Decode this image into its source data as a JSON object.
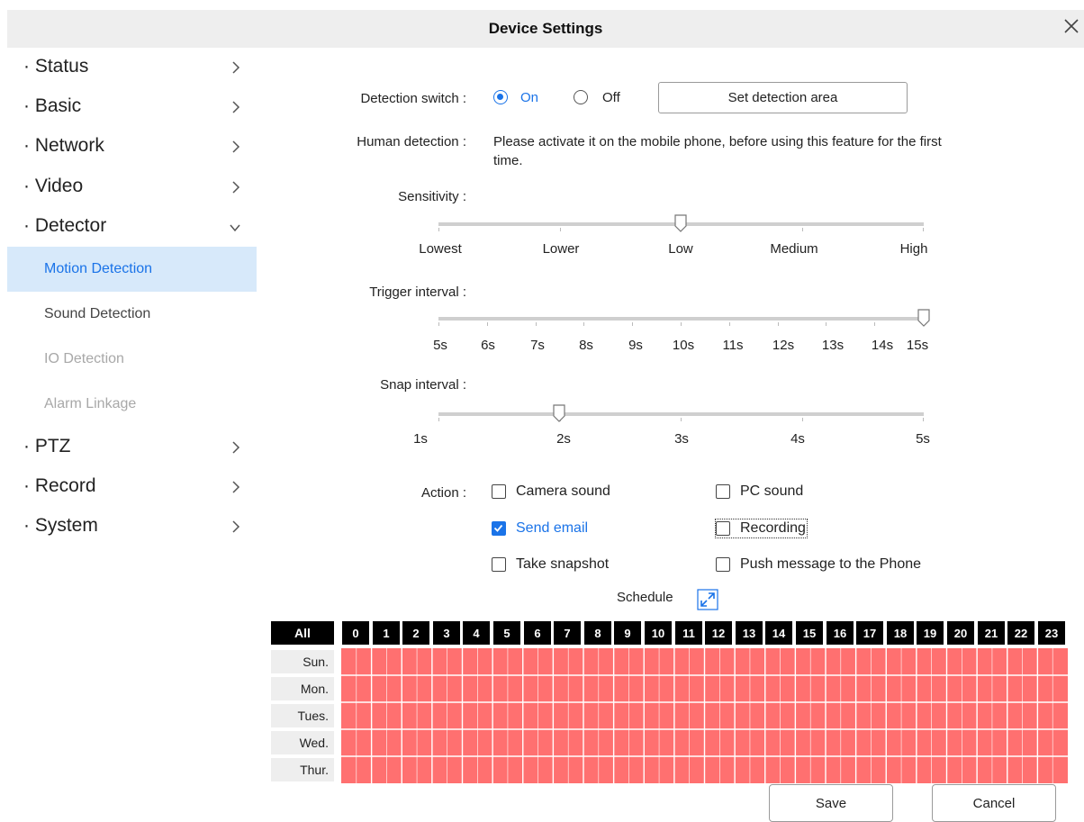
{
  "window": {
    "title": "Device Settings"
  },
  "sidebar": {
    "items": [
      {
        "label": "· Status"
      },
      {
        "label": "· Basic"
      },
      {
        "label": "· Network"
      },
      {
        "label": "· Video"
      },
      {
        "label": "· Detector"
      },
      {
        "label": "· PTZ"
      },
      {
        "label": "· Record"
      },
      {
        "label": "· System"
      }
    ],
    "detector_sub": [
      {
        "label": "Motion Detection",
        "state": "active"
      },
      {
        "label": "Sound Detection",
        "state": "normal"
      },
      {
        "label": "IO Detection",
        "state": "disabled"
      },
      {
        "label": "Alarm Linkage",
        "state": "disabled"
      }
    ]
  },
  "detection": {
    "switch_label": "Detection switch :",
    "on_label": "On",
    "off_label": "Off",
    "selected": "On",
    "area_button": "Set detection area",
    "human_label": "Human detection :",
    "human_text_line1": "Please activate it on the mobile phone, before using this feature for the first",
    "human_text_line2": "time."
  },
  "sensitivity": {
    "label": "Sensitivity :",
    "ticks": [
      "Lowest",
      "Lower",
      "Low",
      "Medium",
      "High"
    ],
    "value": "Low"
  },
  "trigger": {
    "label": "Trigger interval :",
    "ticks": [
      "5s",
      "6s",
      "7s",
      "8s",
      "9s",
      "10s",
      "11s",
      "12s",
      "13s",
      "14s",
      "15s"
    ],
    "value": "15s"
  },
  "snap": {
    "label": "Snap interval :",
    "ticks": [
      "1s",
      "2s",
      "3s",
      "4s",
      "5s"
    ],
    "value": "2s"
  },
  "action": {
    "label": "Action :",
    "camera_sound": {
      "label": "Camera sound",
      "checked": false
    },
    "pc_sound": {
      "label": "PC sound",
      "checked": false
    },
    "send_email": {
      "label": "Send email",
      "checked": true
    },
    "recording": {
      "label": "Recording",
      "checked": false
    },
    "take_snapshot": {
      "label": "Take snapshot",
      "checked": false
    },
    "push_message": {
      "label": "Push message to the Phone",
      "checked": false
    }
  },
  "schedule": {
    "label": "Schedule",
    "all_label": "All",
    "hours": [
      "0",
      "1",
      "2",
      "3",
      "4",
      "5",
      "6",
      "7",
      "8",
      "9",
      "10",
      "11",
      "12",
      "13",
      "14",
      "15",
      "16",
      "17",
      "18",
      "19",
      "20",
      "21",
      "22",
      "23"
    ],
    "days": [
      "Sun.",
      "Mon.",
      "Tues.",
      "Wed.",
      "Thur."
    ],
    "active_color": "#ff7070"
  },
  "footer": {
    "save": "Save",
    "cancel": "Cancel"
  },
  "colors": {
    "accent": "#1a73e8",
    "active_bg": "#d7e9fa",
    "disabled_text": "#a8a8a8"
  }
}
